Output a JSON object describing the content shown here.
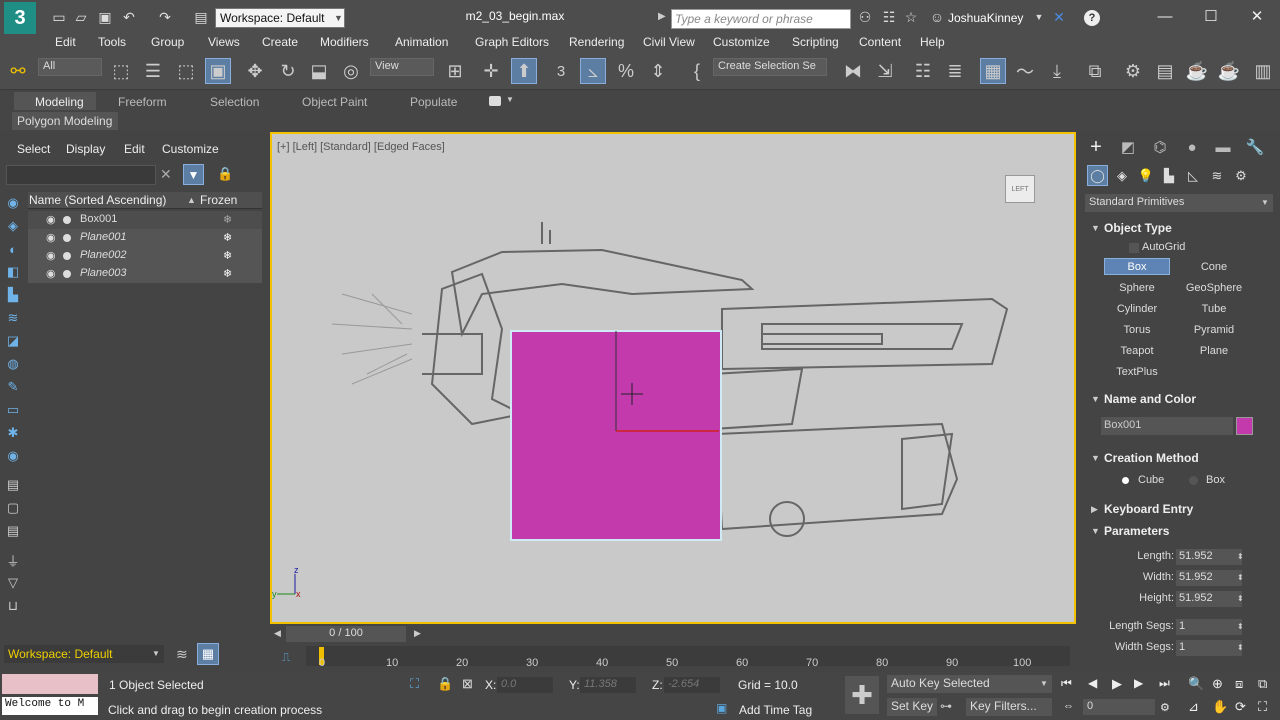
{
  "titlebar": {
    "logo_text": "3",
    "workspace_label": "Workspace: Default",
    "filename": "m2_03_begin.max",
    "search_placeholder": "Type a keyword or phrase",
    "user": "JoshuaKinney",
    "help": "?"
  },
  "menu": [
    "Edit",
    "Tools",
    "Group",
    "Views",
    "Create",
    "Modifiers",
    "Animation",
    "Graph Editors",
    "Rendering",
    "Civil View",
    "Customize",
    "Scripting",
    "Content",
    "Help"
  ],
  "toolbar": {
    "selection_filter": "All",
    "ref_coord": "View",
    "selection_set": "Create Selection Se",
    "snap_label": "3"
  },
  "ribbon": {
    "tabs": [
      "Modeling",
      "Freeform",
      "Selection",
      "Object Paint",
      "Populate"
    ],
    "active_tab": "Modeling",
    "panel_label": "Polygon Modeling"
  },
  "scene_explorer": {
    "menu": [
      "Select",
      "Display",
      "Edit",
      "Customize"
    ],
    "column_name": "Name (Sorted Ascending)",
    "column_frozen": "Frozen",
    "sort_arrow": "▲",
    "rows": [
      {
        "name": "Box001",
        "italic": false
      },
      {
        "name": "Plane001",
        "italic": true
      },
      {
        "name": "Plane002",
        "italic": true
      },
      {
        "name": "Plane003",
        "italic": true
      }
    ],
    "workspace": "Workspace: Default"
  },
  "viewport": {
    "label": "[+] [Left] [Standard] [Edged Faces]",
    "viewcube_label": "LEFT",
    "object_color": "#c33aad"
  },
  "command_panel": {
    "category": "Standard Primitives",
    "object_type_title": "Object Type",
    "autogrid": "AutoGrid",
    "primitives": [
      "Box",
      "Cone",
      "Sphere",
      "GeoSphere",
      "Cylinder",
      "Tube",
      "Torus",
      "Pyramid",
      "Teapot",
      "Plane",
      "TextPlus"
    ],
    "selected_primitive": "Box",
    "name_color_title": "Name and Color",
    "object_name": "Box001",
    "creation_title": "Creation Method",
    "creation_options": [
      "Cube",
      "Box"
    ],
    "creation_selected": "Cube",
    "keyboard_title": "Keyboard Entry",
    "parameters_title": "Parameters",
    "params": [
      {
        "label": "Length:",
        "value": "51.952"
      },
      {
        "label": "Width:",
        "value": "51.952"
      },
      {
        "label": "Height:",
        "value": "51.952"
      },
      {
        "label": "Length Segs:",
        "value": "1"
      },
      {
        "label": "Width Segs:",
        "value": "1"
      }
    ]
  },
  "timeline": {
    "frame_label": "0 / 100",
    "ticks": [
      "0",
      "10",
      "20",
      "30",
      "40",
      "50",
      "60",
      "70",
      "80",
      "90",
      "100"
    ]
  },
  "status": {
    "maxscript_welcome": "Welcome to M",
    "selected_count": "1 Object Selected",
    "prompt": "Click and drag to begin creation process",
    "x_label": "X:",
    "x_value": "0.0",
    "y_label": "Y:",
    "y_value": "11.358",
    "z_label": "Z:",
    "z_value": "-2.654",
    "grid": "Grid = 10.0",
    "add_time_tag": "Add Time Tag",
    "auto_key": "Auto Key",
    "set_key": "Set Key",
    "key_mode": "Selected",
    "key_filters": "Key Filters...",
    "frame": "0"
  }
}
